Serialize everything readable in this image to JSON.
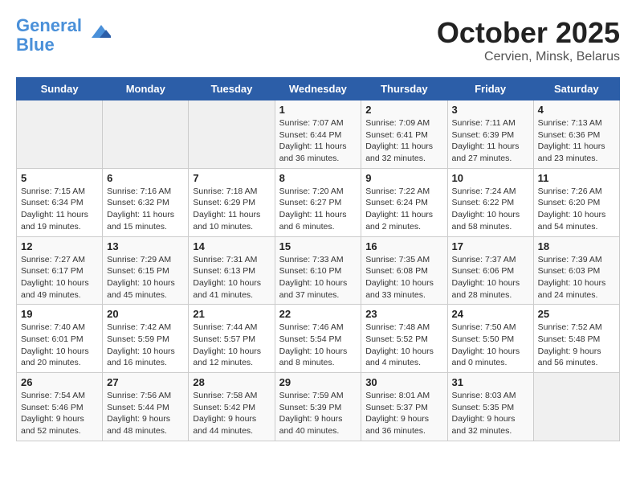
{
  "header": {
    "logo_line1": "General",
    "logo_line2": "Blue",
    "month": "October 2025",
    "location": "Cervien, Minsk, Belarus"
  },
  "days_of_week": [
    "Sunday",
    "Monday",
    "Tuesday",
    "Wednesday",
    "Thursday",
    "Friday",
    "Saturday"
  ],
  "weeks": [
    [
      {
        "day": "",
        "info": ""
      },
      {
        "day": "",
        "info": ""
      },
      {
        "day": "",
        "info": ""
      },
      {
        "day": "1",
        "info": "Sunrise: 7:07 AM\nSunset: 6:44 PM\nDaylight: 11 hours\nand 36 minutes."
      },
      {
        "day": "2",
        "info": "Sunrise: 7:09 AM\nSunset: 6:41 PM\nDaylight: 11 hours\nand 32 minutes."
      },
      {
        "day": "3",
        "info": "Sunrise: 7:11 AM\nSunset: 6:39 PM\nDaylight: 11 hours\nand 27 minutes."
      },
      {
        "day": "4",
        "info": "Sunrise: 7:13 AM\nSunset: 6:36 PM\nDaylight: 11 hours\nand 23 minutes."
      }
    ],
    [
      {
        "day": "5",
        "info": "Sunrise: 7:15 AM\nSunset: 6:34 PM\nDaylight: 11 hours\nand 19 minutes."
      },
      {
        "day": "6",
        "info": "Sunrise: 7:16 AM\nSunset: 6:32 PM\nDaylight: 11 hours\nand 15 minutes."
      },
      {
        "day": "7",
        "info": "Sunrise: 7:18 AM\nSunset: 6:29 PM\nDaylight: 11 hours\nand 10 minutes."
      },
      {
        "day": "8",
        "info": "Sunrise: 7:20 AM\nSunset: 6:27 PM\nDaylight: 11 hours\nand 6 minutes."
      },
      {
        "day": "9",
        "info": "Sunrise: 7:22 AM\nSunset: 6:24 PM\nDaylight: 11 hours\nand 2 minutes."
      },
      {
        "day": "10",
        "info": "Sunrise: 7:24 AM\nSunset: 6:22 PM\nDaylight: 10 hours\nand 58 minutes."
      },
      {
        "day": "11",
        "info": "Sunrise: 7:26 AM\nSunset: 6:20 PM\nDaylight: 10 hours\nand 54 minutes."
      }
    ],
    [
      {
        "day": "12",
        "info": "Sunrise: 7:27 AM\nSunset: 6:17 PM\nDaylight: 10 hours\nand 49 minutes."
      },
      {
        "day": "13",
        "info": "Sunrise: 7:29 AM\nSunset: 6:15 PM\nDaylight: 10 hours\nand 45 minutes."
      },
      {
        "day": "14",
        "info": "Sunrise: 7:31 AM\nSunset: 6:13 PM\nDaylight: 10 hours\nand 41 minutes."
      },
      {
        "day": "15",
        "info": "Sunrise: 7:33 AM\nSunset: 6:10 PM\nDaylight: 10 hours\nand 37 minutes."
      },
      {
        "day": "16",
        "info": "Sunrise: 7:35 AM\nSunset: 6:08 PM\nDaylight: 10 hours\nand 33 minutes."
      },
      {
        "day": "17",
        "info": "Sunrise: 7:37 AM\nSunset: 6:06 PM\nDaylight: 10 hours\nand 28 minutes."
      },
      {
        "day": "18",
        "info": "Sunrise: 7:39 AM\nSunset: 6:03 PM\nDaylight: 10 hours\nand 24 minutes."
      }
    ],
    [
      {
        "day": "19",
        "info": "Sunrise: 7:40 AM\nSunset: 6:01 PM\nDaylight: 10 hours\nand 20 minutes."
      },
      {
        "day": "20",
        "info": "Sunrise: 7:42 AM\nSunset: 5:59 PM\nDaylight: 10 hours\nand 16 minutes."
      },
      {
        "day": "21",
        "info": "Sunrise: 7:44 AM\nSunset: 5:57 PM\nDaylight: 10 hours\nand 12 minutes."
      },
      {
        "day": "22",
        "info": "Sunrise: 7:46 AM\nSunset: 5:54 PM\nDaylight: 10 hours\nand 8 minutes."
      },
      {
        "day": "23",
        "info": "Sunrise: 7:48 AM\nSunset: 5:52 PM\nDaylight: 10 hours\nand 4 minutes."
      },
      {
        "day": "24",
        "info": "Sunrise: 7:50 AM\nSunset: 5:50 PM\nDaylight: 10 hours\nand 0 minutes."
      },
      {
        "day": "25",
        "info": "Sunrise: 7:52 AM\nSunset: 5:48 PM\nDaylight: 9 hours\nand 56 minutes."
      }
    ],
    [
      {
        "day": "26",
        "info": "Sunrise: 7:54 AM\nSunset: 5:46 PM\nDaylight: 9 hours\nand 52 minutes."
      },
      {
        "day": "27",
        "info": "Sunrise: 7:56 AM\nSunset: 5:44 PM\nDaylight: 9 hours\nand 48 minutes."
      },
      {
        "day": "28",
        "info": "Sunrise: 7:58 AM\nSunset: 5:42 PM\nDaylight: 9 hours\nand 44 minutes."
      },
      {
        "day": "29",
        "info": "Sunrise: 7:59 AM\nSunset: 5:39 PM\nDaylight: 9 hours\nand 40 minutes."
      },
      {
        "day": "30",
        "info": "Sunrise: 8:01 AM\nSunset: 5:37 PM\nDaylight: 9 hours\nand 36 minutes."
      },
      {
        "day": "31",
        "info": "Sunrise: 8:03 AM\nSunset: 5:35 PM\nDaylight: 9 hours\nand 32 minutes."
      },
      {
        "day": "",
        "info": ""
      }
    ]
  ]
}
